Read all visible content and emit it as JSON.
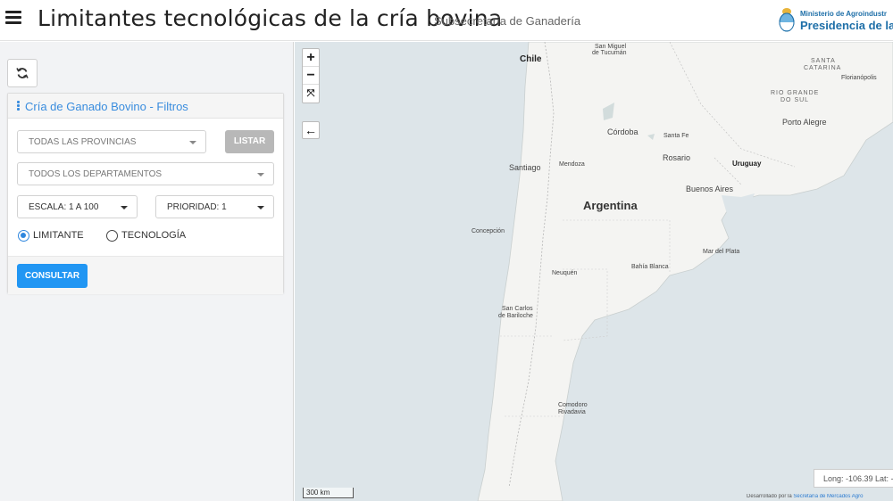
{
  "header": {
    "title": "Limitantes tecnológicas de la cría bovina",
    "subtitle": "Subsecretaría de Ganadería",
    "logo_line1": "Ministerio de Agroindustr",
    "logo_line2": "Presidencia de la N"
  },
  "filters": {
    "panel_title": "Cría de Ganado Bovino - Filtros",
    "provincias": "TODAS LAS PROVINCIAS",
    "listar_label": "LISTAR",
    "departamentos": "TODOS LOS DEPARTAMENTOS",
    "escala": "ESCALA: 1 A 100",
    "prioridad": "PRIORIDAD: 1",
    "radio_limitante": "LIMITANTE",
    "radio_tecnologia": "TECNOLOGÍA",
    "selected_radio": "LIMITANTE",
    "consultar_label": "CONSULTAR"
  },
  "map": {
    "zoom_in": "+",
    "zoom_out": "−",
    "fullscreen_icon": "⤧",
    "back_icon": "←",
    "scale_label": "300 km",
    "coords_text": "Long: -106.39 Lat: -",
    "credit_prefix": "Desarrollado por la ",
    "credit_link": "Secretaría de Mercados Agro",
    "labels": {
      "chile": "Chile",
      "argentina": "Argentina",
      "uruguay": "Uruguay",
      "san_miguel": "San Miguel",
      "de_tucuman": "de Tucumán",
      "santa_catarina_1": "SANTA",
      "santa_catarina_2": "CATARINA",
      "florianopolis": "Florianópolis",
      "rio_grande_1": "RIO GRANDE",
      "rio_grande_2": "DO SUL",
      "porto_alegre": "Porto Alegre",
      "cordoba": "Córdoba",
      "santa_fe": "Santa Fe",
      "rosario": "Rosario",
      "santiago": "Santiago",
      "mendoza": "Mendoza",
      "buenos_aires": "Buenos Aires",
      "concepcion": "Concepción",
      "mar_del_plata": "Mar del Plata",
      "bahia_blanca": "Bahía Blanca",
      "neuquen": "Neuquén",
      "san_carlos_1": "San Carlos",
      "san_carlos_2": "de Bariloche",
      "comodoro_1": "Comodoro",
      "comodoro_2": "Rivadavia"
    }
  },
  "colors": {
    "accent": "#2196f3",
    "panel_title": "#3a8dde",
    "logo": "#1e6fa8",
    "land": "#f4f4f2",
    "water": "#dde5e9"
  }
}
